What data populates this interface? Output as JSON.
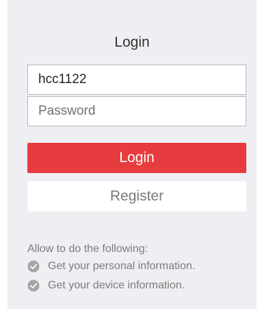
{
  "login": {
    "title": "Login",
    "username_value": "hcc1122",
    "password_placeholder": "Password",
    "login_label": "Login",
    "register_label": "Register"
  },
  "permissions": {
    "heading": "Allow to do the following:",
    "items": [
      {
        "label": "Get your personal information.",
        "icon": "check-circle-icon"
      },
      {
        "label": "Get your device information.",
        "icon": "check-circle-icon"
      }
    ]
  },
  "colors": {
    "panel_background": "#efeef2",
    "login_button": "#e73c3f",
    "register_button": "#ffffff",
    "check_icon": "#a5a5a5"
  }
}
